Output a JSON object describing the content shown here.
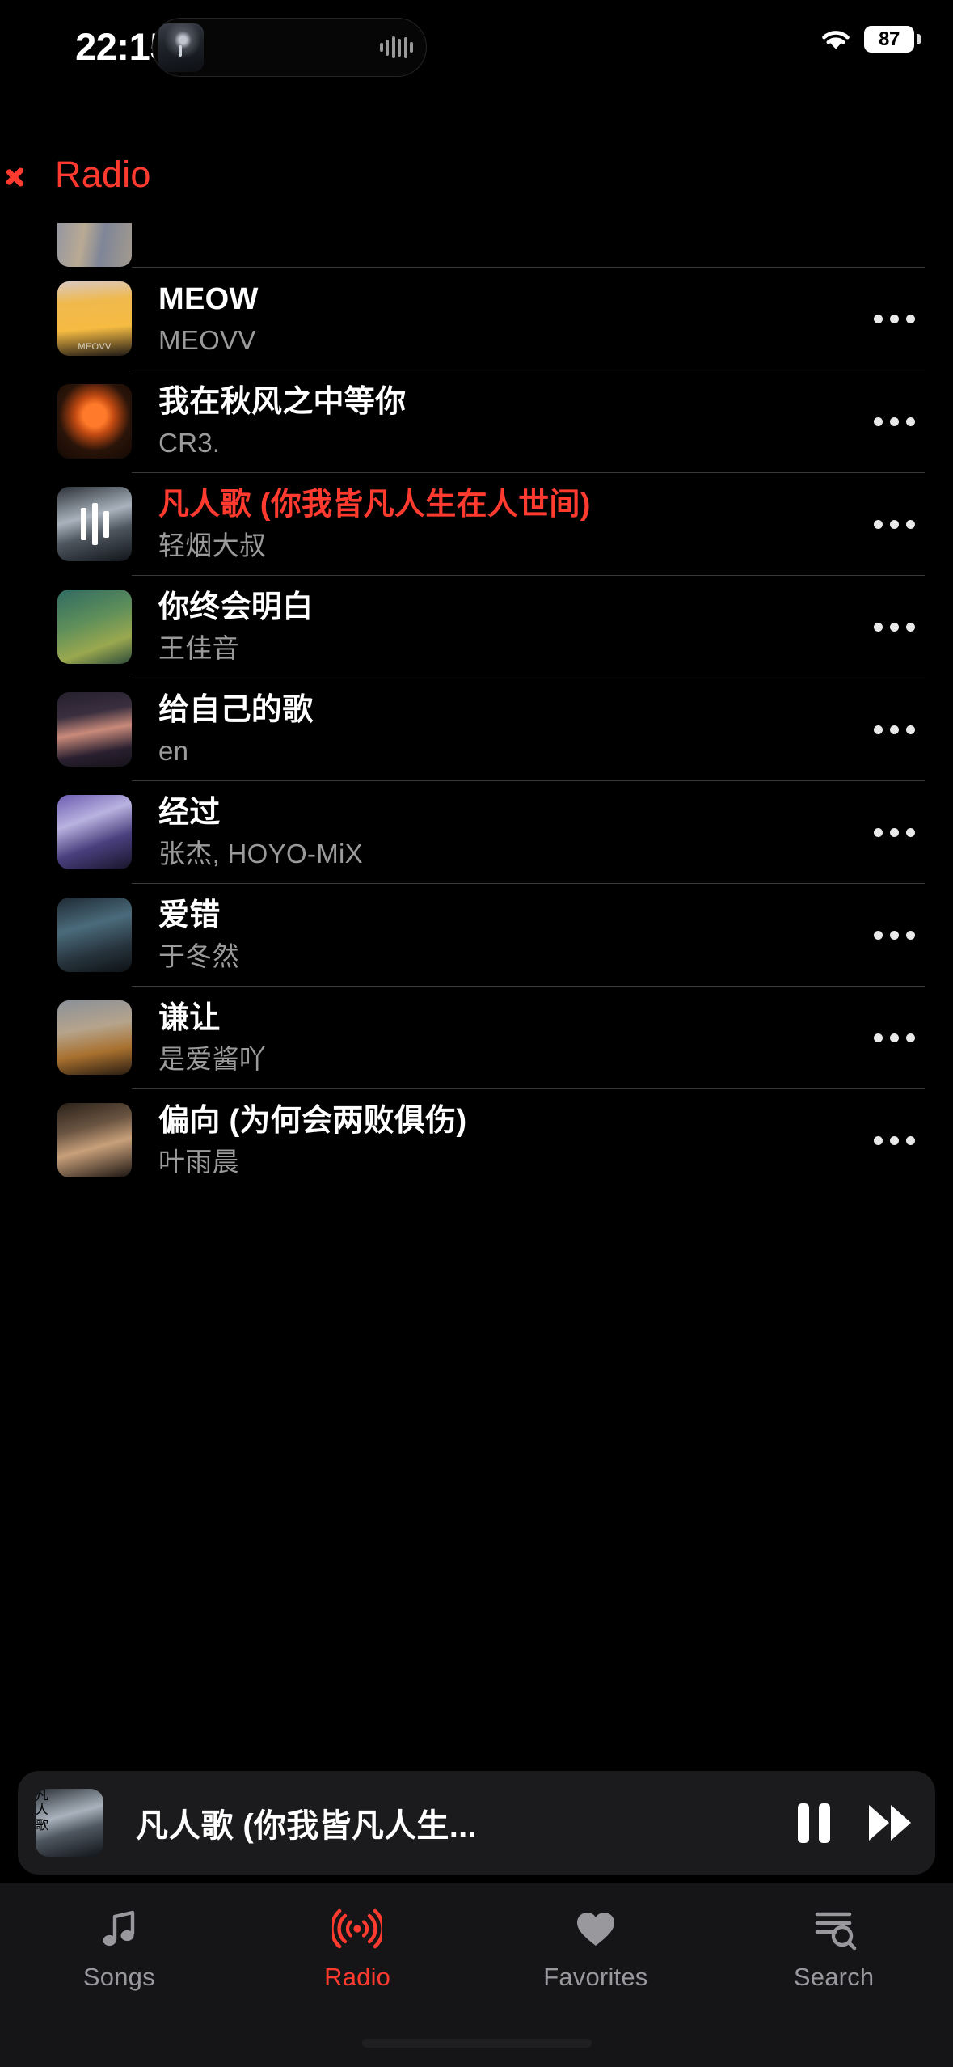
{
  "status_bar": {
    "time": "22:15",
    "battery_level": "87",
    "wifi_icon": "wifi-icon",
    "island_waveform_icon": "audio-waveform-icon"
  },
  "nav": {
    "back_icon": "chevron-left-icon",
    "title": "Radio"
  },
  "colors": {
    "accent": "#ff3b30",
    "background": "#000000",
    "secondary_text": "#9b9b9b",
    "divider": "#3a3a3c"
  },
  "list": {
    "more_icon": "ellipsis-icon",
    "items": [
      {
        "title": "",
        "artist": "",
        "art": "bg-scrolltop",
        "active": false,
        "clipped": true
      },
      {
        "title": "MEOW",
        "artist": "MEOVV",
        "art": "bg-meow",
        "art_caption": "MEOVV",
        "active": false,
        "clipped": false
      },
      {
        "title": "我在秋风之中等你",
        "artist": "CR3.",
        "art": "bg-qiufeng",
        "art_caption": "",
        "active": false,
        "clipped": false
      },
      {
        "title": "凡人歌 (你我皆凡人生在人世间)",
        "artist": "轻烟大叔",
        "art": "bg-fanrenge",
        "art_caption": "",
        "active": true,
        "clipped": false
      },
      {
        "title": "你终会明白",
        "artist": "王佳音",
        "art": "bg-zhongming",
        "art_caption": "",
        "active": false,
        "clipped": false
      },
      {
        "title": "给自己的歌",
        "artist": "en",
        "art": "bg-geiziji",
        "art_caption": "",
        "active": false,
        "clipped": false
      },
      {
        "title": "经过",
        "artist": "张杰, HOYO-MiX",
        "art": "bg-jingguo",
        "art_caption": "",
        "active": false,
        "clipped": false
      },
      {
        "title": "爱错",
        "artist": "于冬然",
        "art": "bg-aicuo",
        "art_caption": "",
        "active": false,
        "clipped": false
      },
      {
        "title": "谦让",
        "artist": "是爱酱吖",
        "art": "bg-qianrang",
        "art_caption": "",
        "active": false,
        "clipped": false
      },
      {
        "title": "偏向 (为何会两败俱伤)",
        "artist": "叶雨晨",
        "art": "bg-pianxiang",
        "art_caption": "",
        "active": false,
        "clipped": false
      }
    ]
  },
  "mini_player": {
    "title": "凡人歌 (你我皆凡人生...",
    "pause_icon": "pause-icon",
    "next_icon": "fast-forward-icon",
    "art": "bg-fanrenge"
  },
  "tab_bar": {
    "tabs": [
      {
        "label": "Songs",
        "icon": "music-note-icon",
        "active": false
      },
      {
        "label": "Radio",
        "icon": "broadcast-icon",
        "active": true
      },
      {
        "label": "Favorites",
        "icon": "heart-icon",
        "active": false
      },
      {
        "label": "Search",
        "icon": "list-search-icon",
        "active": false
      }
    ]
  }
}
